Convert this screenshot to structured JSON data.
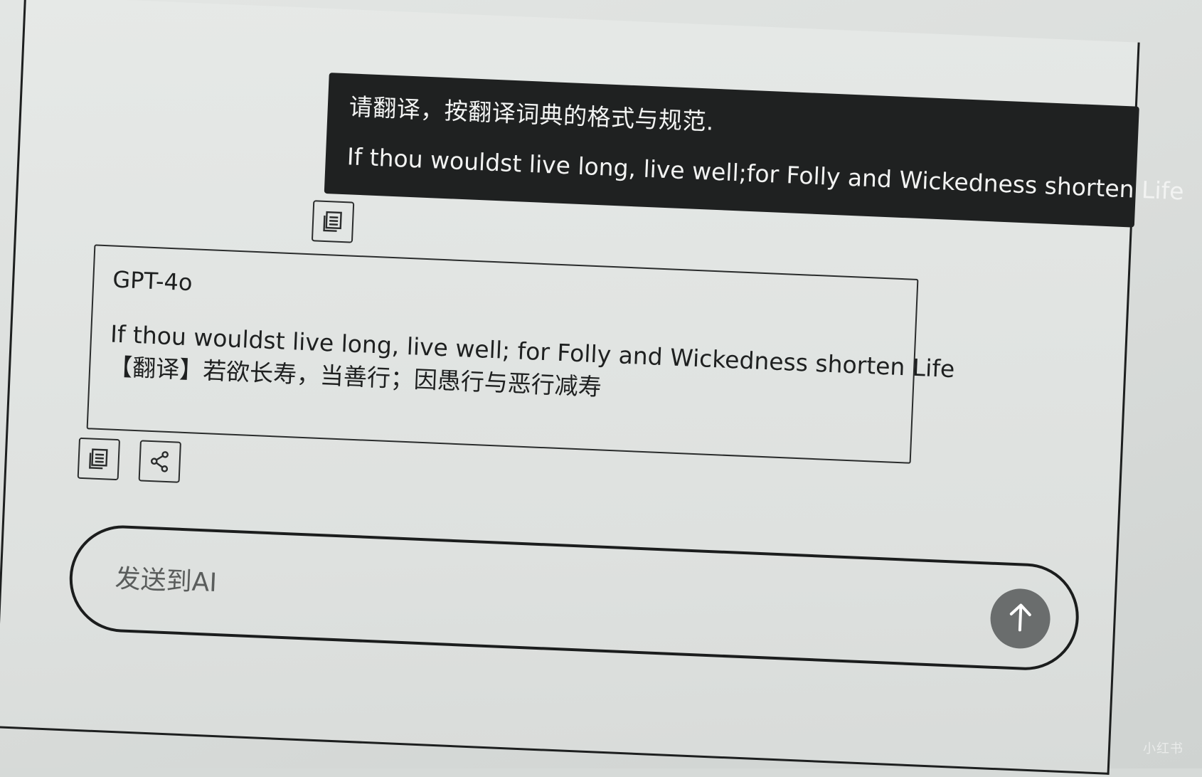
{
  "conversation": {
    "user_message": {
      "line1": "请翻译，按翻译词典的格式与规范.",
      "line2": "If thou wouldst live long, live well;for Folly and Wickedness shorten Life"
    },
    "ai_response": {
      "model": "GPT-4o",
      "line1": "If thou wouldst live long, live well; for Folly and Wickedness shorten Life",
      "line2": "【翻译】若欲长寿，当善行；因愚行与恶行减寿"
    }
  },
  "composer": {
    "placeholder": "发送到AI"
  },
  "watermark": "小红书",
  "icons": {
    "copy": "copy-icon",
    "share": "share-icon",
    "send": "arrow-up-icon"
  },
  "colors": {
    "user_bubble_bg": "#1f2121",
    "send_button_bg": "#6a6d6d",
    "screen_bg": "#e3e6e4"
  }
}
